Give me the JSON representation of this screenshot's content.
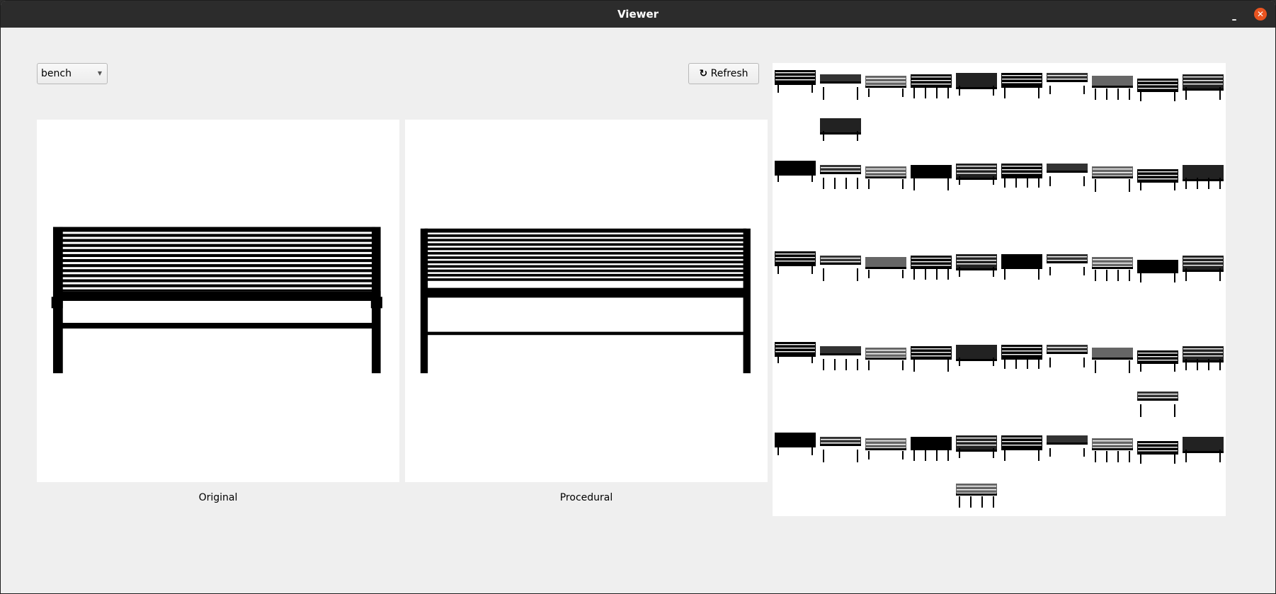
{
  "window": {
    "title": "Viewer",
    "minimize": "–",
    "close": "✕"
  },
  "toolbar": {
    "category": "bench",
    "refresh_label": "Refresh",
    "refresh_icon": "↻"
  },
  "panels": {
    "original_label": "Original",
    "procedural_label": "Procedural"
  },
  "gallery": {
    "rows": 5,
    "columns": 10
  }
}
